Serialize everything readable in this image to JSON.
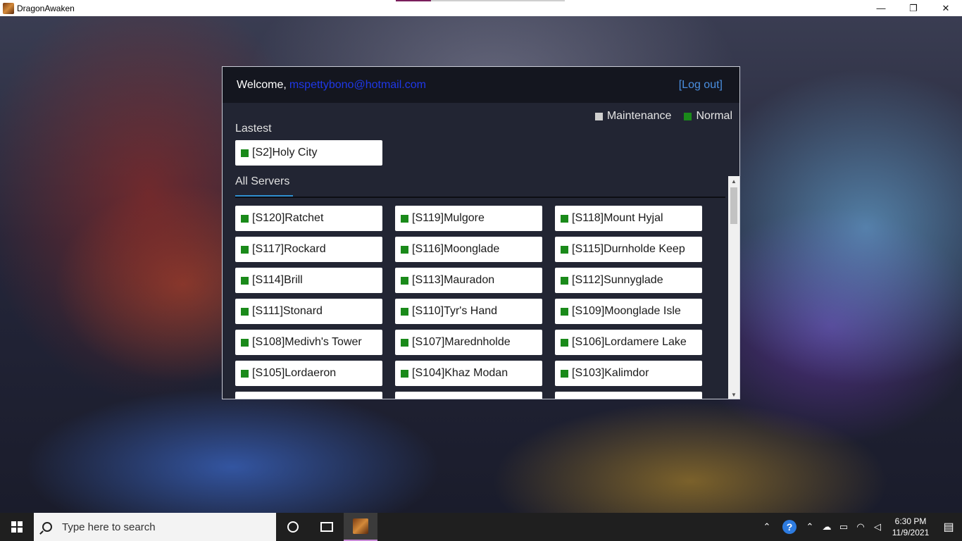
{
  "window": {
    "title": "DragonAwaken",
    "minimize": "—",
    "maximize": "❐",
    "close": "✕"
  },
  "header": {
    "welcome": "Welcome,",
    "email": "mspettybono@hotmail.com",
    "logout": "[Log out]"
  },
  "legend": {
    "maintenance": "Maintenance",
    "normal": "Normal"
  },
  "colors": {
    "status_normal": "#1a8a1a",
    "status_maintenance": "#cfcfcf",
    "tab_accent": "#2f8fd0"
  },
  "latest": {
    "label": "Lastest",
    "server": "[S2]Holy City"
  },
  "tabs": {
    "all_servers": "All Servers"
  },
  "servers": [
    "[S120]Ratchet",
    "[S119]Mulgore",
    "[S118]Mount Hyjal",
    "[S117]Rockard",
    "[S116]Moonglade",
    "[S115]Durnholde Keep",
    "[S114]Brill",
    "[S113]Mauradon",
    "[S112]Sunnyglade",
    "[S111]Stonard",
    "[S110]Tyr's Hand",
    "[S109]Moonglade Isle",
    "[S108]Medivh's Tower",
    "[S107]Marednholde",
    "[S106]Lordamere Lake",
    "[S105]Lordaeron",
    "[S104]Khaz Modan",
    "[S103]Kalimdor"
  ],
  "scrollbar": {
    "up": "▲",
    "down": "▼"
  },
  "taskbar": {
    "search_placeholder": "Type here to search",
    "time": "6:30 PM",
    "date": "11/9/2021"
  },
  "tray_icons": [
    "chevron-up-icon",
    "onedrive-icon",
    "battery-icon",
    "wifi-icon",
    "volume-muted-icon"
  ]
}
